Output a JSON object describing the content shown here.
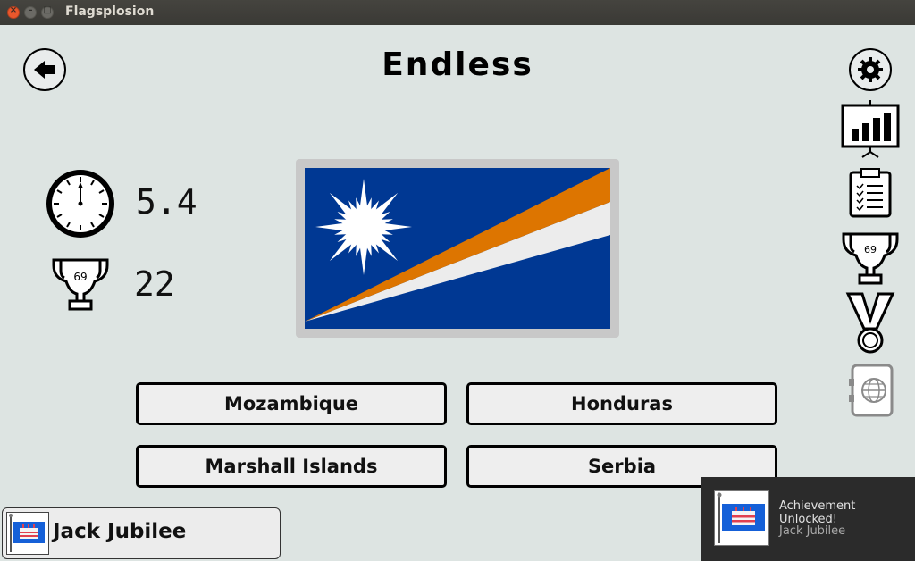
{
  "window": {
    "title": "Flagsplosion"
  },
  "header": {
    "title": "Endless"
  },
  "stats": {
    "timer_value": "5.4",
    "trophy_badge": "69",
    "score_value": "22"
  },
  "sidebar": {
    "trophy_badge": "69"
  },
  "answers": [
    "Mozambique",
    "Honduras",
    "Marshall Islands",
    "Serbia"
  ],
  "achievement_banner": {
    "label": "Jack Jubilee"
  },
  "toast": {
    "title": "Achievement Unlocked!",
    "subtitle": "Jack Jubilee"
  },
  "colors": {
    "background": "#dde4e2",
    "flag_blue": "#003893",
    "flag_orange": "#dd7500",
    "flag_white": "#ffffff"
  }
}
